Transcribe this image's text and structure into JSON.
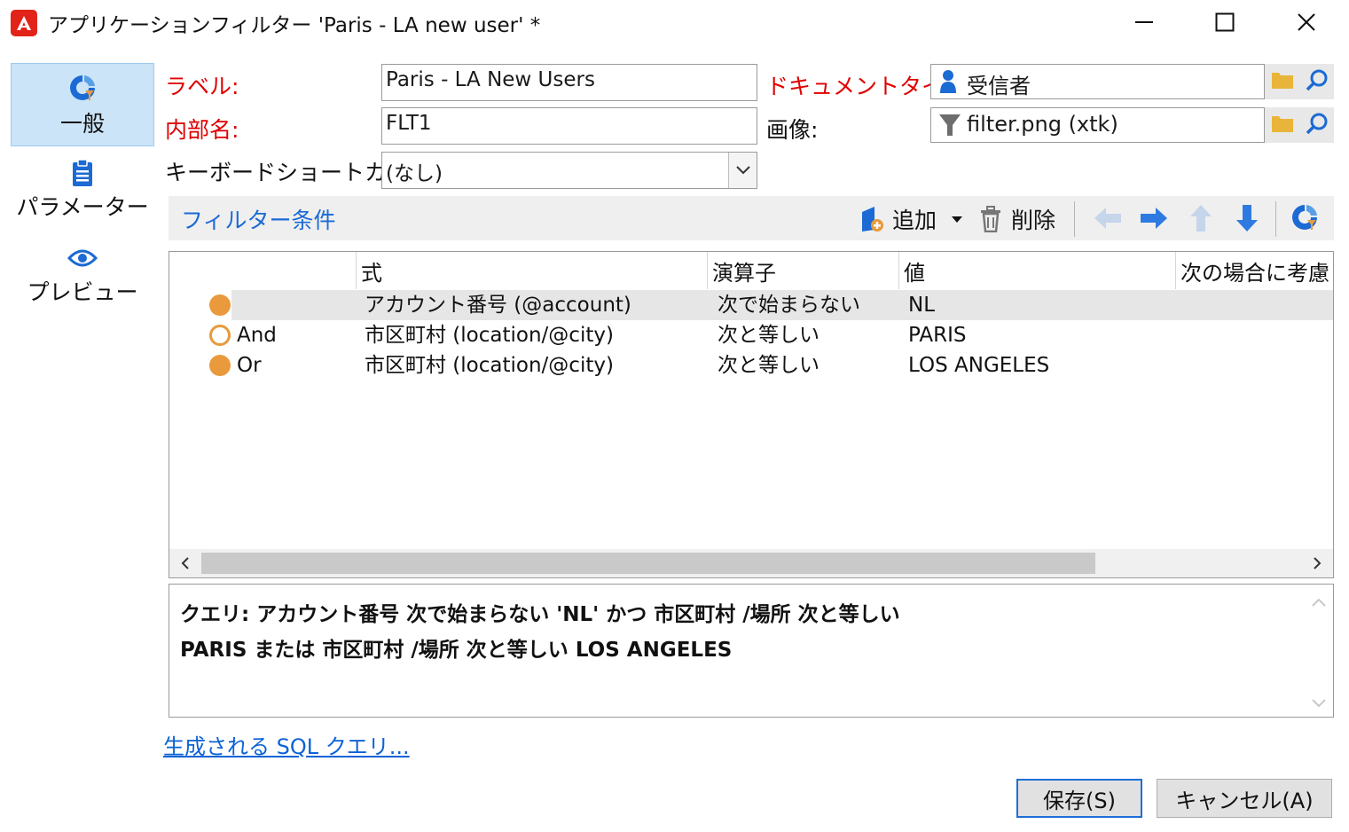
{
  "window": {
    "title": "アプリケーションフィルター 'Paris - LA new user' *",
    "controls": {
      "minimize": "minimize-icon",
      "maximize": "maximize-icon",
      "close": "close-icon"
    }
  },
  "nav": {
    "items": [
      {
        "label": "一般",
        "icon": "general-icon",
        "active": true
      },
      {
        "label": "パラメーター",
        "icon": "clipboard-icon",
        "active": false
      },
      {
        "label": "プレビュー",
        "icon": "eye-icon",
        "active": false
      }
    ]
  },
  "form": {
    "label_caption": "ラベル:",
    "label_value": "Paris - LA New Users",
    "internal_name_caption": "内部名:",
    "internal_name_value": "FLT1",
    "shortcut_caption": "キーボードショートカット:",
    "shortcut_value": "(なし)",
    "doctype_caption": "ドキュメントタイプ:",
    "doctype_value": "受信者",
    "image_caption": "画像:",
    "image_value": "filter.png (xtk)"
  },
  "filter": {
    "title": "フィルター条件",
    "add_label": "追加",
    "delete_label": "削除",
    "columns": [
      "式",
      "演算子",
      "値",
      "次の場合に考慮"
    ],
    "rows": [
      {
        "conj": "",
        "expression": "アカウント番号 (@account)",
        "operator": "次で始まらない",
        "value": "NL",
        "selected": true
      },
      {
        "conj": "And",
        "expression": "市区町村 (location/@city)",
        "operator": "次と等しい",
        "value": "PARIS",
        "selected": false
      },
      {
        "conj": "Or",
        "expression": "市区町村 (location/@city)",
        "operator": "次と等しい",
        "value": "LOS ANGELES",
        "selected": false
      }
    ]
  },
  "query": {
    "line1": "クエリ: アカウント番号 次で始まらない 'NL' かつ 市区町村 /場所 次と等しい",
    "line2": "PARIS または 市区町村 /場所 次と等しい LOS ANGELES"
  },
  "sql_link": "生成される SQL クエリ...",
  "buttons": {
    "save": "保存(S)",
    "cancel": "キャンセル(A)"
  },
  "colors": {
    "accent": "#1c6ad4",
    "required_label": "#e00000",
    "nav_active": "#cce4f7",
    "condition_dot": "#e89a3c"
  }
}
